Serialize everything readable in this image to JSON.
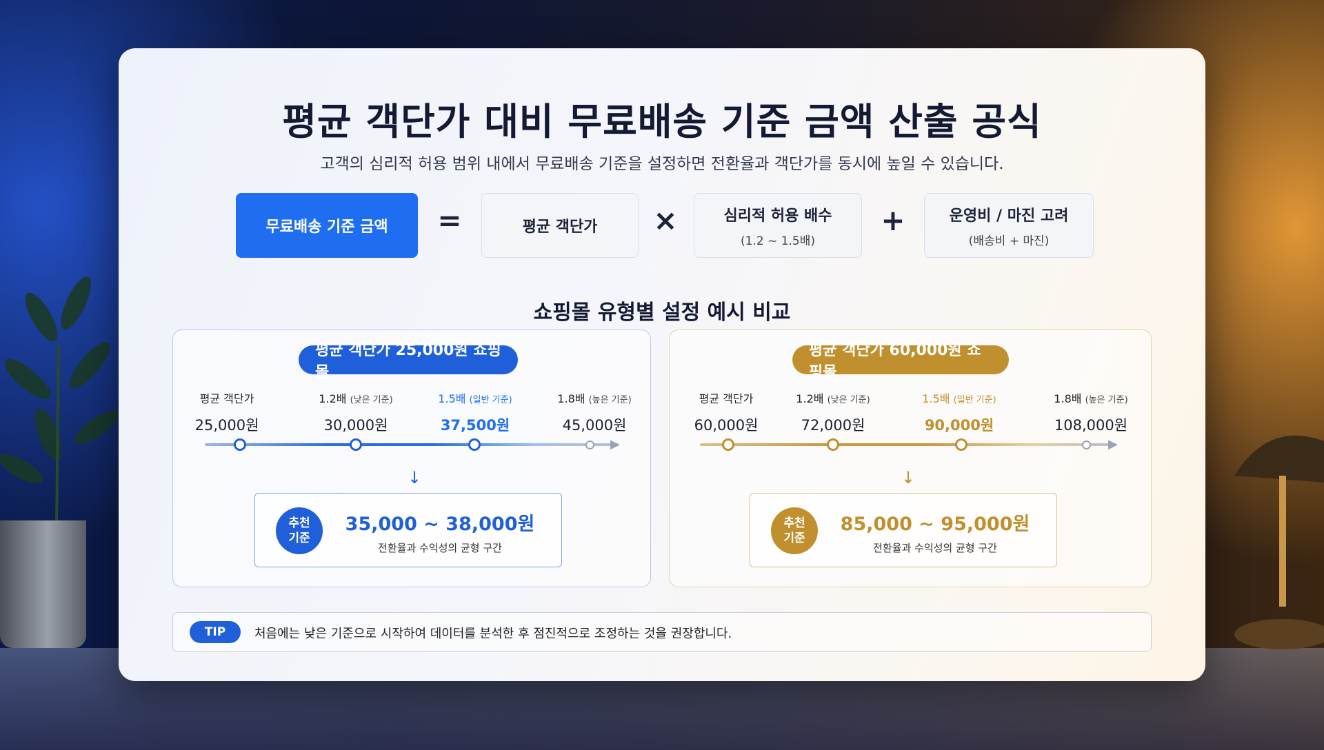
{
  "title": "평균 객단가 대비 무료배송 기준 금액 산출 공식",
  "subtitle": "고객의 심리적 허용 범위 내에서 무료배송 기준을 설정하면 전환율과 객단가를 동시에 높일 수 있습니다.",
  "formula": {
    "result": "무료배송 기준 금액",
    "equals": "=",
    "term1": "평균 객단가",
    "times": "×",
    "term2": "심리적 허용 배수",
    "term2_sub": "(1.2 ~ 1.5배)",
    "plus": "+",
    "term3": "운영비 / 마진 고려",
    "term3_sub": "(배송비 + 마진)"
  },
  "section_title": "쇼핑몰 유형별 설정 예시 비교",
  "panels": [
    {
      "header": "평균 객단가 25,000원 쇼핑몰",
      "stats": [
        {
          "label": "평균 객단가",
          "note": "",
          "value": "25,000원"
        },
        {
          "label": "1.2배",
          "note": "(낮은 기준)",
          "value": "30,000원"
        },
        {
          "label": "1.5배",
          "note": "(일반 기준)",
          "value": "37,500원"
        },
        {
          "label": "1.8배",
          "note": "(높은 기준)",
          "value": "45,000원"
        }
      ],
      "arrow": "↓",
      "badge_line1": "추천",
      "badge_line2": "기준",
      "recommend": "35,000 ~ 38,000원",
      "recommend_desc": "전환율과 수익성의 균형 구간"
    },
    {
      "header": "평균 객단가 60,000원 쇼핑몰",
      "stats": [
        {
          "label": "평균 객단가",
          "note": "",
          "value": "60,000원"
        },
        {
          "label": "1.2배",
          "note": "(낮은 기준)",
          "value": "72,000원"
        },
        {
          "label": "1.5배",
          "note": "(일반 기준)",
          "value": "90,000원"
        },
        {
          "label": "1.8배",
          "note": "(높은 기준)",
          "value": "108,000원"
        }
      ],
      "arrow": "↓",
      "badge_line1": "추천",
      "badge_line2": "기준",
      "recommend": "85,000 ~ 95,000원",
      "recommend_desc": "전환율과 수익성의 균형 구간"
    }
  ],
  "tip": {
    "badge": "TIP",
    "text": "처음에는 낮은 기준으로 시작하여 데이터를 분석한 후 점진적으로 조정하는 것을 권장합니다."
  },
  "colors": {
    "blue_accent": "#1f6ef2",
    "gold_accent": "#c08f2e",
    "title_text": "#141a33"
  }
}
